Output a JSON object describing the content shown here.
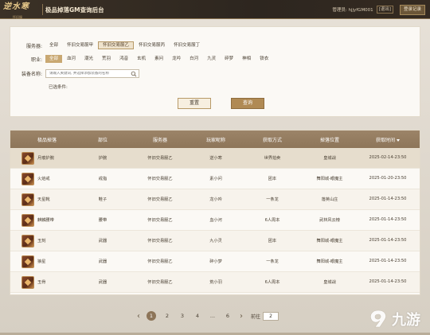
{
  "header": {
    "logo_text": "逆水寒",
    "logo_sub": "怀旧服",
    "title": "极品掉落GM查询后台",
    "admin_label": "管理员: hjjyfGM001",
    "logout_label": "[退出]",
    "reset_login_label": "登录记录"
  },
  "filters": {
    "server_label": "服务器:",
    "servers": [
      {
        "label": "全部",
        "state": "plain"
      },
      {
        "label": "怀旧交易服甲",
        "state": "plain"
      },
      {
        "label": "怀旧交易服乙",
        "state": "active-outline"
      },
      {
        "label": "怀旧交易服丙",
        "state": "plain"
      },
      {
        "label": "怀旧交易服丁",
        "state": "plain"
      }
    ],
    "class_label": "职业:",
    "classes": [
      {
        "label": "全部",
        "state": "active"
      },
      {
        "label": "血河",
        "state": "plain"
      },
      {
        "label": "潮光",
        "state": "plain"
      },
      {
        "label": "荒羽",
        "state": "plain"
      },
      {
        "label": "鸿音",
        "state": "plain"
      },
      {
        "label": "玄机",
        "state": "plain"
      },
      {
        "label": "素问",
        "state": "plain"
      },
      {
        "label": "龙吟",
        "state": "plain"
      },
      {
        "label": "白河",
        "state": "plain"
      },
      {
        "label": "九灵",
        "state": "plain"
      },
      {
        "label": "碎梦",
        "state": "plain"
      },
      {
        "label": "神相",
        "state": "plain"
      },
      {
        "label": "铁衣",
        "state": "plain"
      }
    ],
    "equip_label": "装备名称:",
    "equip_placeholder": "请输入关键词, 并选择添加装备的名称",
    "selected_label": "已选条件:",
    "reset_label": "重置",
    "query_label": "查询"
  },
  "table": {
    "headers": [
      "极品掉落",
      "部位",
      "服务器",
      "玩家昵称",
      "获取方式",
      "掉落位置",
      "获取时间"
    ],
    "rows": [
      {
        "name": "月痕护腕",
        "slot": "护腕",
        "server": "怀旧交易服乙",
        "player": "逆小寒",
        "method": "世界拍卖",
        "location": "皇城战",
        "time": "2025-02-14-23:50"
      },
      {
        "name": "火焰戒",
        "slot": "戒指",
        "server": "怀旧交易服乙",
        "player": "素小问",
        "method": "团本",
        "location": "舞阳城-眼魔主",
        "time": "2025-01-20-23:50"
      },
      {
        "name": "天星靴",
        "slot": "鞋子",
        "server": "怀旧交易服乙",
        "player": "龙小吟",
        "method": "一条龙",
        "location": "落英山庄",
        "time": "2025-01-14-23:50"
      },
      {
        "name": "麒麟腰带",
        "slot": "腰带",
        "server": "怀旧交易服乙",
        "player": "血小河",
        "method": "6人周本",
        "location": "武林风云榜",
        "time": "2025-01-14-23:50"
      },
      {
        "name": "玉刻",
        "slot": "武器",
        "server": "怀旧交易服乙",
        "player": "九小灵",
        "method": "团本",
        "location": "舞阳城-眼魔主",
        "time": "2025-01-14-23:50"
      },
      {
        "name": "狼星",
        "slot": "武器",
        "server": "怀旧交易服乙",
        "player": "碎小梦",
        "method": "一条龙",
        "location": "舞阳城-眼魔主",
        "time": "2025-01-14-23:50"
      },
      {
        "name": "玉骨",
        "slot": "武器",
        "server": "怀旧交易服乙",
        "player": "荒小羽",
        "method": "6人周本",
        "location": "皇城战",
        "time": "2025-01-14-23:50"
      }
    ]
  },
  "pager": {
    "prev": "‹",
    "pages": [
      "1",
      "2",
      "3",
      "4",
      "...",
      "6"
    ],
    "current": "1",
    "next": "›",
    "jump_label": "前往",
    "jump_value": "2"
  },
  "watermark": {
    "text": "九游"
  },
  "colors": {
    "accent": "#c9a872",
    "header_bg": "#2d261f",
    "table_head": "#8d7559"
  }
}
